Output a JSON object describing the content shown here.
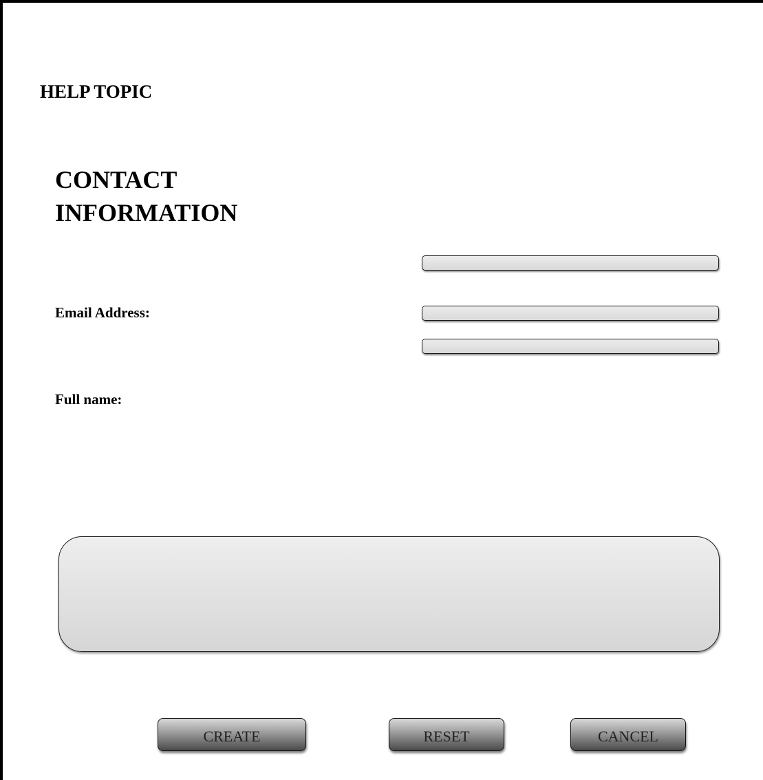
{
  "header": {
    "help_topic": "HELP TOPIC",
    "section_title": "CONTACT INFORMATION"
  },
  "form": {
    "email_label": "Email Address:",
    "fullname_label": "Full name:"
  },
  "buttons": {
    "create": "CREATE",
    "reset": "RESET",
    "cancel": "CANCEL"
  },
  "colors": {
    "field_fill": "#e0e0e0",
    "button_dark": "#4a4a4a",
    "frame": "#000000"
  }
}
